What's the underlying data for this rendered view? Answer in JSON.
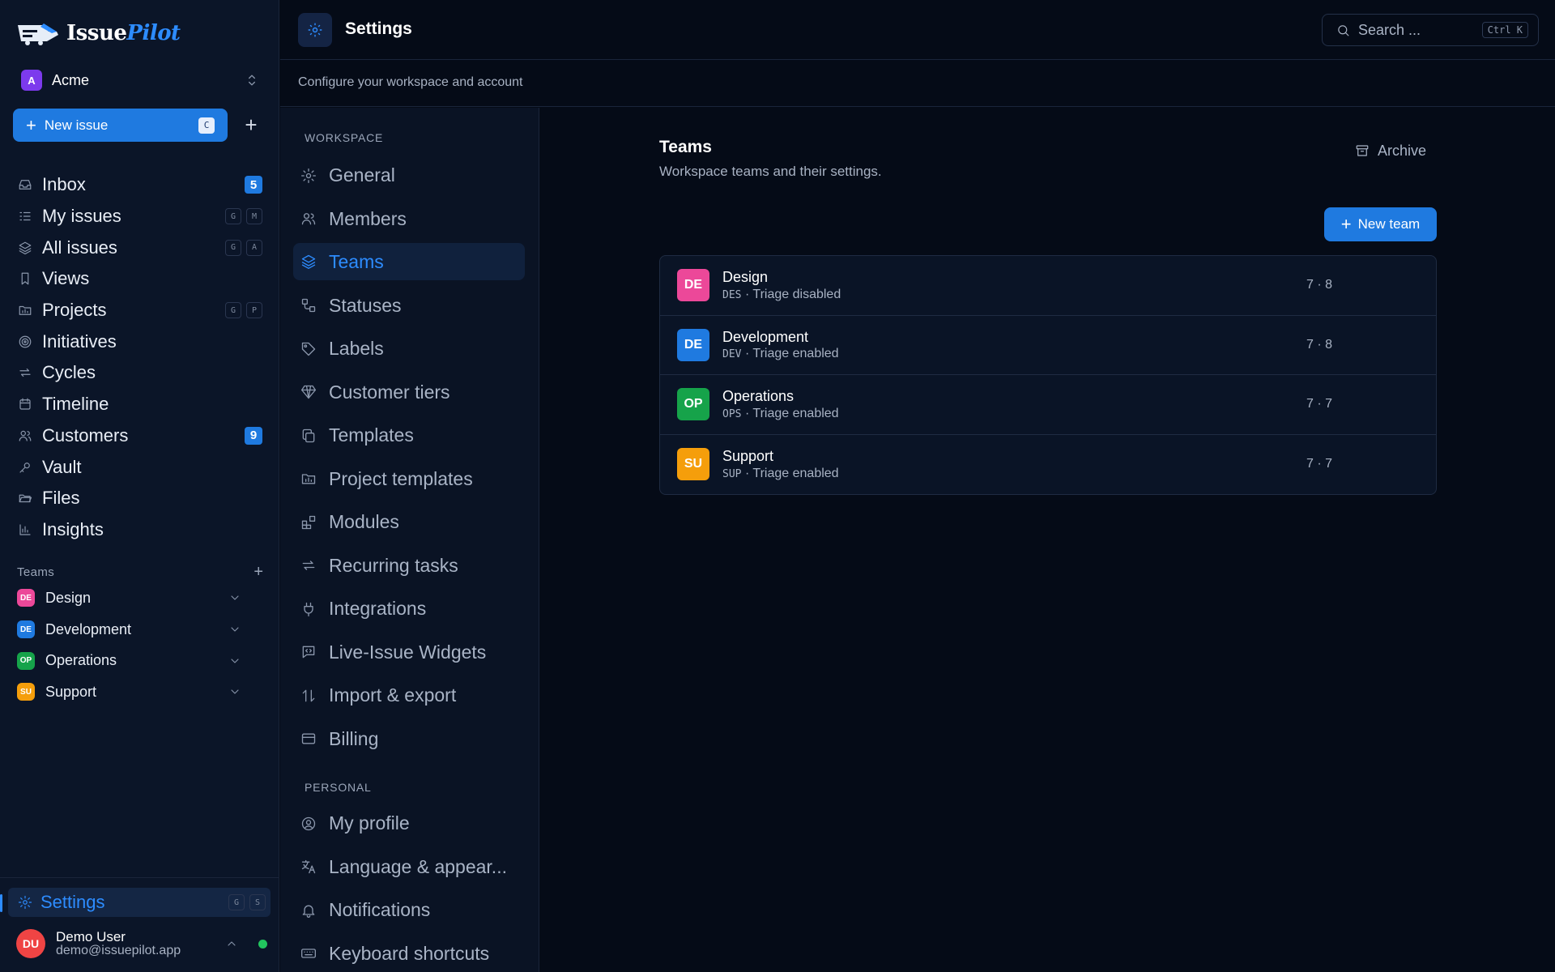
{
  "app": {
    "logo_part1": "Issue",
    "logo_part2": "Pilot"
  },
  "workspace": {
    "initial": "A",
    "name": "Acme",
    "color": "#7c3aed"
  },
  "sidebar": {
    "new_issue_label": "New issue",
    "new_issue_key": "C",
    "nav": [
      {
        "label": "Inbox",
        "icon": "inbox-icon",
        "badge": "5"
      },
      {
        "label": "My issues",
        "icon": "list-check-icon",
        "keys": [
          "G",
          "M"
        ]
      },
      {
        "label": "All issues",
        "icon": "layers-icon",
        "keys": [
          "G",
          "A"
        ]
      },
      {
        "label": "Views",
        "icon": "bookmark-icon"
      },
      {
        "label": "Projects",
        "icon": "folder-chart-icon",
        "keys": [
          "G",
          "P"
        ]
      },
      {
        "label": "Initiatives",
        "icon": "target-icon"
      },
      {
        "label": "Cycles",
        "icon": "repeat-icon"
      },
      {
        "label": "Timeline",
        "icon": "calendar-icon"
      },
      {
        "label": "Customers",
        "icon": "users-icon",
        "badge": "9"
      },
      {
        "label": "Vault",
        "icon": "key-icon"
      },
      {
        "label": "Files",
        "icon": "folder-open-icon"
      },
      {
        "label": "Insights",
        "icon": "bar-chart-icon"
      }
    ],
    "teams_header": "Teams",
    "teams": [
      {
        "initials": "DE",
        "name": "Design",
        "color": "#ec4899"
      },
      {
        "initials": "DE",
        "name": "Development",
        "color": "#1f7ae0"
      },
      {
        "initials": "OP",
        "name": "Operations",
        "color": "#16a34a"
      },
      {
        "initials": "SU",
        "name": "Support",
        "color": "#f59e0b"
      }
    ],
    "settings_label": "Settings",
    "settings_keys": [
      "G",
      "S"
    ],
    "user": {
      "initials": "DU",
      "name": "Demo User",
      "email": "demo@issuepilot.app"
    }
  },
  "header": {
    "title": "Settings",
    "search_placeholder": "Search ...",
    "search_shortcut": "Ctrl K",
    "subtitle": "Configure your workspace and account"
  },
  "settings_nav": {
    "workspace_label": "WORKSPACE",
    "workspace_items": [
      {
        "label": "General",
        "icon": "gear-icon"
      },
      {
        "label": "Members",
        "icon": "users-icon"
      },
      {
        "label": "Teams",
        "icon": "layers-icon",
        "active": true
      },
      {
        "label": "Statuses",
        "icon": "workflow-icon"
      },
      {
        "label": "Labels",
        "icon": "tag-icon"
      },
      {
        "label": "Customer tiers",
        "icon": "gem-icon"
      },
      {
        "label": "Templates",
        "icon": "copy-icon"
      },
      {
        "label": "Project templates",
        "icon": "folder-chart-icon"
      },
      {
        "label": "Modules",
        "icon": "blocks-icon"
      },
      {
        "label": "Recurring tasks",
        "icon": "repeat-icon"
      },
      {
        "label": "Integrations",
        "icon": "plug-icon"
      },
      {
        "label": "Live-Issue Widgets",
        "icon": "message-code-icon"
      },
      {
        "label": "Import & export",
        "icon": "arrows-up-down-icon"
      },
      {
        "label": "Billing",
        "icon": "credit-card-icon"
      }
    ],
    "personal_label": "PERSONAL",
    "personal_items": [
      {
        "label": "My profile",
        "icon": "user-circle-icon"
      },
      {
        "label": "Language & appear...",
        "icon": "languages-icon"
      },
      {
        "label": "Notifications",
        "icon": "bell-icon"
      },
      {
        "label": "Keyboard shortcuts",
        "icon": "keyboard-icon"
      }
    ]
  },
  "teams_page": {
    "title": "Teams",
    "subtitle": "Workspace teams and their settings.",
    "archive_label": "Archive",
    "new_team_label": "New team",
    "rows": [
      {
        "initials": "DE",
        "name": "Design",
        "code": "DES",
        "triage": "· Triage disabled",
        "counts": "7 · 8",
        "color": "#ec4899"
      },
      {
        "initials": "DE",
        "name": "Development",
        "code": "DEV",
        "triage": "· Triage enabled",
        "counts": "7 · 8",
        "color": "#1f7ae0"
      },
      {
        "initials": "OP",
        "name": "Operations",
        "code": "OPS",
        "triage": "· Triage enabled",
        "counts": "7 · 7",
        "color": "#16a34a"
      },
      {
        "initials": "SU",
        "name": "Support",
        "code": "SUP",
        "triage": "· Triage enabled",
        "counts": "7 · 7",
        "color": "#f59e0b"
      }
    ]
  }
}
